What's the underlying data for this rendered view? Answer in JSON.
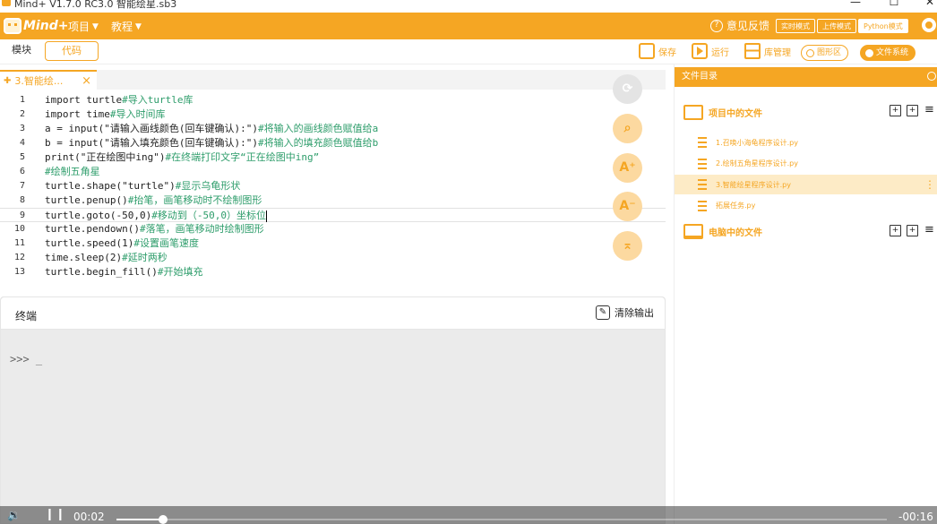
{
  "window": {
    "title": "Mind+ V1.7.0 RC3.0   智能绘星.sb3",
    "minimize": "—",
    "maximize": "☐",
    "close": "✕"
  },
  "menubar": {
    "logo_text": "Mind+",
    "items": [
      {
        "label": "项目"
      },
      {
        "label": "教程"
      }
    ],
    "feedback": "意见反馈",
    "modes": [
      {
        "label": "实时模式",
        "active": false
      },
      {
        "label": "上传模式",
        "active": false
      },
      {
        "label": "Python模式",
        "active": true
      }
    ]
  },
  "toolbar": {
    "tab_modules": "模块",
    "tab_code": "代码",
    "save": "保存",
    "run": "运行",
    "library": "库管理",
    "shape_area": "图形区",
    "file_system": "文件系统"
  },
  "editor": {
    "tab_name": "3.智能绘...",
    "tab_close": "×",
    "lines": [
      {
        "n": "1",
        "code": "import turtle",
        "comment": "#导入turtle库"
      },
      {
        "n": "2",
        "code": "import time",
        "comment": "#导入时间库"
      },
      {
        "n": "3",
        "code": "a = input(\"请输入画线颜色(回车键确认):\")",
        "comment": "#将输入的画线颜色赋值给a"
      },
      {
        "n": "4",
        "code": "b = input(\"请输入填充颜色(回车键确认):\")",
        "comment": "#将输入的填充颜色赋值给b"
      },
      {
        "n": "5",
        "code": "print(\"正在绘图中ing\")",
        "comment": "#在终端打印文字“正在绘图中ing”"
      },
      {
        "n": "6",
        "code": "",
        "comment": "#绘制五角星"
      },
      {
        "n": "7",
        "code": "turtle.shape(\"turtle\")",
        "comment": "#显示乌龟形状"
      },
      {
        "n": "8",
        "code": "turtle.penup()",
        "comment": "#抬笔，画笔移动时不绘制图形"
      },
      {
        "n": "9",
        "code": "turtle.goto(-50,0)",
        "comment": "#移动到（-50,0）坐标位"
      },
      {
        "n": "10",
        "code": "turtle.pendown()",
        "comment": "#落笔，画笔移动时绘制图形"
      },
      {
        "n": "11",
        "code": "turtle.speed(1)",
        "comment": "#设置画笔速度"
      },
      {
        "n": "12",
        "code": "time.sleep(2)",
        "comment": "#延时两秒"
      },
      {
        "n": "13",
        "code": "turtle.begin_fill()",
        "comment": "#开始填充"
      }
    ],
    "current_line": 9
  },
  "float_buttons": [
    {
      "name": "refresh-button",
      "glyph": "⟳",
      "gray": true
    },
    {
      "name": "search-button",
      "glyph": "⌕",
      "gray": false
    },
    {
      "name": "font-increase-button",
      "glyph": "A⁺",
      "gray": false
    },
    {
      "name": "font-decrease-button",
      "glyph": "A⁻",
      "gray": false
    },
    {
      "name": "scroll-top-button",
      "glyph": "⌅",
      "gray": false
    }
  ],
  "terminal": {
    "title": "终端",
    "clear": "清除输出",
    "prompt": ">>> _"
  },
  "file_panel": {
    "title": "文件目录",
    "project_section": "项目中的文件",
    "pc_section": "电脑中的文件",
    "files": [
      {
        "name": "1.召唤小海龟程序设计.py",
        "active": false
      },
      {
        "name": "2.绘制五角星程序设计.py",
        "active": false
      },
      {
        "name": "3.智能绘星程序设计.py",
        "active": true
      },
      {
        "name": "拓展任务.py",
        "active": false
      }
    ]
  },
  "video": {
    "current_time": "00:02",
    "remaining_time": "-00:16",
    "progress": 0.06
  },
  "colors": {
    "accent": "#f5a623",
    "comment": "#2e9d6b",
    "active_row": "#fdebc6"
  }
}
